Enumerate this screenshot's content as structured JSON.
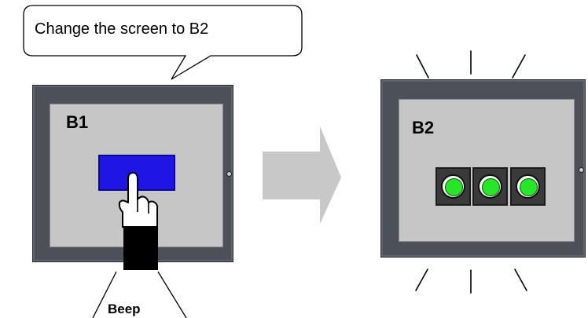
{
  "bubble": {
    "text": "Change the screen to B2"
  },
  "left_panel": {
    "screen_label": "B1"
  },
  "right_panel": {
    "screen_label": "B2",
    "lamps": [
      "green",
      "green",
      "green"
    ]
  },
  "sound": {
    "text": "Beep"
  },
  "colors": {
    "device_bezel": "#4d5058",
    "screen": "#c6c6c6",
    "switch_blue": "#1f16e6",
    "lamp_green": "#27e527",
    "arrow": "#c8c8c8"
  }
}
